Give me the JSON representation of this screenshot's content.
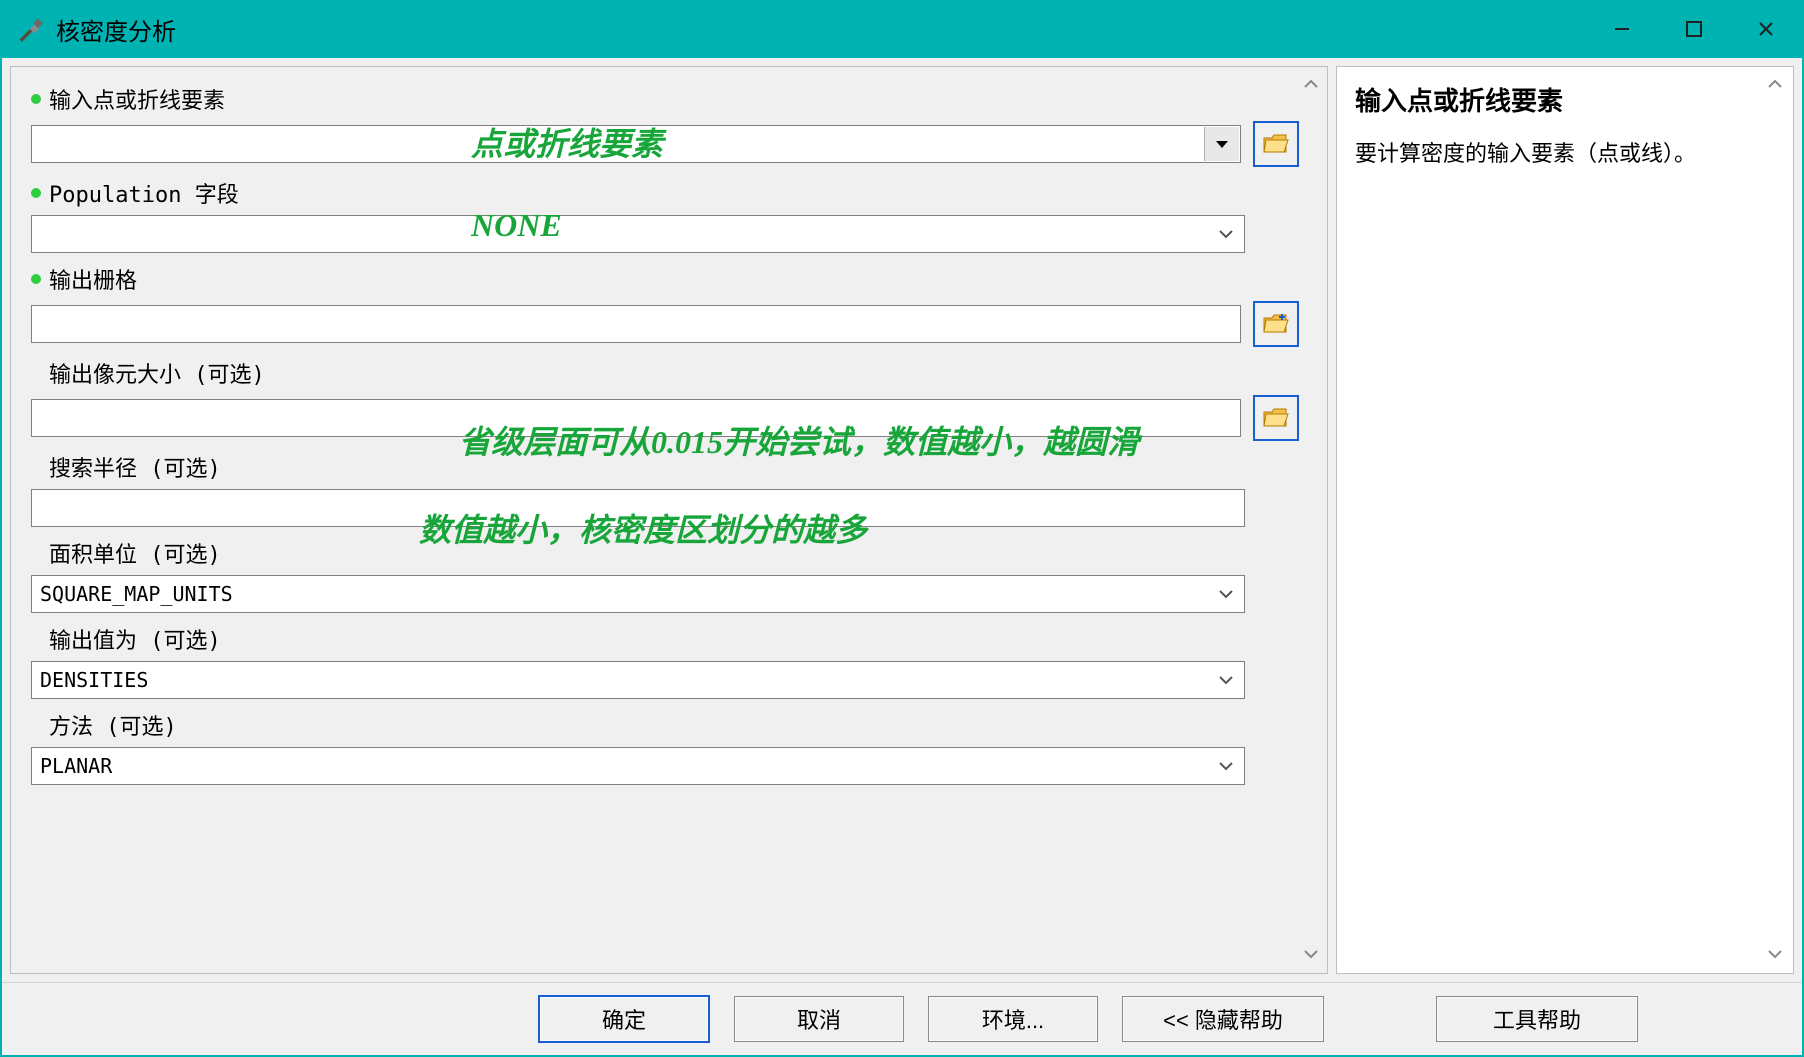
{
  "window": {
    "title": "核密度分析"
  },
  "fields": {
    "input_features": {
      "label": "输入点或折线要素",
      "value": ""
    },
    "population": {
      "label": "Population 字段",
      "value": ""
    },
    "output_raster": {
      "label": "输出栅格",
      "value": ""
    },
    "cell_size": {
      "label": "输出像元大小 (可选)",
      "value": ""
    },
    "search_radius": {
      "label": "搜索半径 (可选)",
      "value": ""
    },
    "area_units": {
      "label": "面积单位 (可选)",
      "value": "SQUARE_MAP_UNITS"
    },
    "output_values": {
      "label": "输出值为 (可选)",
      "value": "DENSITIES"
    },
    "method": {
      "label": "方法 (可选)",
      "value": "PLANAR"
    }
  },
  "annotations": {
    "input_features": "点或折线要素",
    "population": "NONE",
    "cell_size": "省级层面可从0.015开始尝试，数值越小，越圆滑",
    "search_radius": "数值越小，核密度区划分的越多"
  },
  "help": {
    "title": "输入点或折线要素",
    "body": "要计算密度的输入要素（点或线）。"
  },
  "buttons": {
    "ok": "确定",
    "cancel": "取消",
    "env": "环境...",
    "hide_help": "<< 隐藏帮助",
    "tool_help": "工具帮助"
  }
}
